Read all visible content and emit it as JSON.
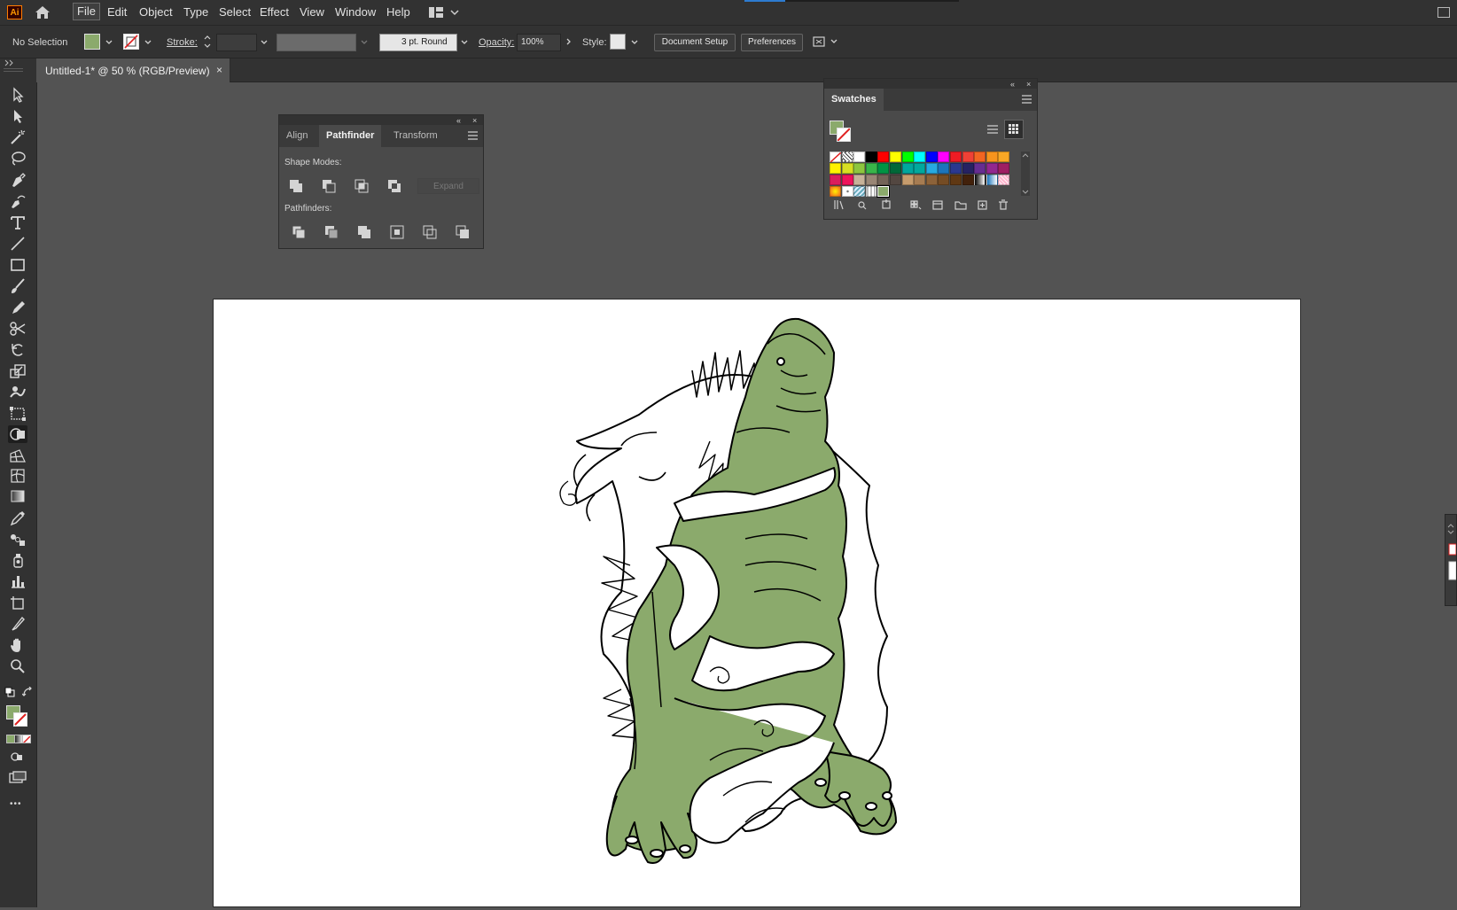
{
  "app": {
    "logo_text": "Ai",
    "menu": [
      "File",
      "Edit",
      "Object",
      "Type",
      "Select",
      "Effect",
      "View",
      "Window",
      "Help"
    ],
    "active_menu": "File"
  },
  "control_bar": {
    "selection_label": "No Selection",
    "stroke_label": "Stroke:",
    "brush_value": "3 pt. Round",
    "opacity_label": "Opacity:",
    "opacity_value": "100%",
    "style_label": "Style:",
    "document_setup_label": "Document Setup",
    "preferences_label": "Preferences",
    "fill_color": "#8BAA6C"
  },
  "document": {
    "tab_title": "Untitled-1* @ 50 % (RGB/Preview)",
    "close_glyph": "×"
  },
  "pathfinder_panel": {
    "tabs": [
      "Align",
      "Pathfinder",
      "Transform"
    ],
    "active_tab": "Pathfinder",
    "shape_modes_label": "Shape Modes:",
    "pathfinders_label": "Pathfinders:",
    "expand_label": "Expand",
    "collapse_glyph": "«",
    "close_glyph": "×"
  },
  "swatches_panel": {
    "title": "Swatches",
    "collapse_glyph": "«",
    "close_glyph": "×",
    "active_fill": "#8BAA6C",
    "rows": [
      [
        "none",
        "registration",
        "#FFFFFF",
        "#000000",
        "#FF0000",
        "#FFFF00",
        "#00FF00",
        "#00FFFF",
        "#0000FF",
        "#FF00FF",
        "#ED1C24",
        "#EF4136",
        "#F26522",
        "#F7941D",
        "#F9A825"
      ],
      [
        "#FFF200",
        "#D7DF23",
        "#8DC63F",
        "#39B54A",
        "#009444",
        "#006838",
        "#00A79D",
        "#00A99D",
        "#27AAE1",
        "#1C75BC",
        "#2B388F",
        "#262262",
        "#662D91",
        "#92278F",
        "#9E1F63"
      ],
      [
        "#DA1C5C",
        "#ED145B",
        "#C7B299",
        "#998675",
        "#736357",
        "#534741",
        "#C69C6D",
        "#A67C52",
        "#8C6239",
        "#754C24",
        "#603813",
        "#42210B",
        "gradient-bw",
        "gradient-blue",
        "pattern-pink"
      ],
      [
        "gradient-orange",
        "pattern-dots",
        "pattern-blue",
        "pattern-check",
        "#8BAA6C"
      ]
    ]
  },
  "toolbar": {
    "tools": [
      "selection-tool",
      "direct-selection-tool",
      "magic-wand-tool",
      "lasso-tool",
      "pen-tool",
      "curvature-tool",
      "type-tool",
      "line-tool",
      "rectangle-tool",
      "paintbrush-tool",
      "pencil-tool",
      "scissors-tool",
      "rotate-tool",
      "scale-tool",
      "warp-tool",
      "free-transform-tool",
      "shape-builder-tool",
      "perspective-grid-tool",
      "mesh-tool",
      "gradient-tool",
      "eyedropper-tool",
      "blend-tool",
      "symbol-sprayer-tool",
      "column-graph-tool",
      "artboard-tool",
      "slice-tool",
      "hand-tool",
      "zoom-tool"
    ],
    "fill_color": "#8BAA6C",
    "more_glyph": "•••"
  },
  "artwork": {
    "fill_color": "#8BAA6C",
    "stroke_color": "#000000"
  }
}
